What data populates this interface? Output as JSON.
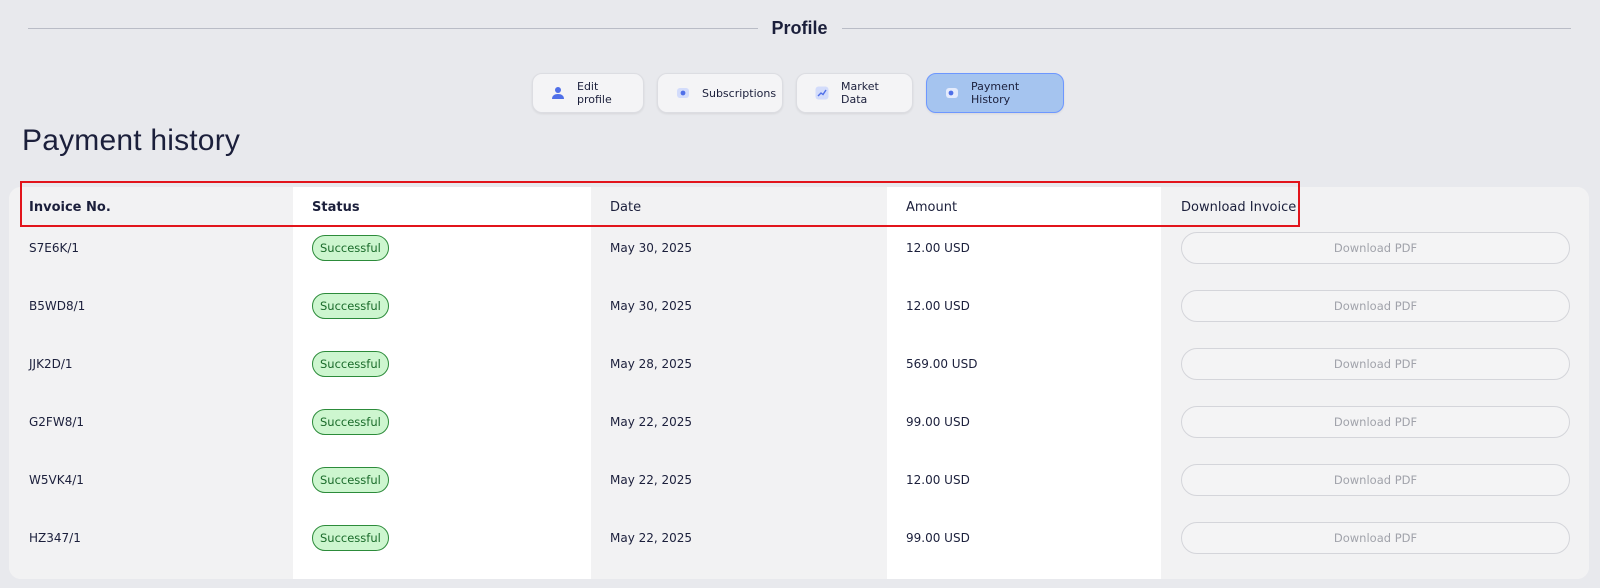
{
  "profile": {
    "title": "Profile"
  },
  "tabs": [
    {
      "label": "Edit profile",
      "icon": "user-icon",
      "active": false
    },
    {
      "label": "Subscriptions",
      "icon": "subscription-icon",
      "active": false
    },
    {
      "label": "Market Data",
      "icon": "chart-icon",
      "active": false
    },
    {
      "label": "Payment History",
      "icon": "payment-icon",
      "active": true
    }
  ],
  "page": {
    "title": "Payment history"
  },
  "table": {
    "headers": {
      "invoice": "Invoice No.",
      "status": "Status",
      "date": "Date",
      "amount": "Amount",
      "download": "Download Invoice"
    },
    "rows": [
      {
        "invoice": "S7E6K/1",
        "status": "Successful",
        "date": "May 30, 2025",
        "amount": "12.00 USD",
        "download": "Download PDF"
      },
      {
        "invoice": "B5WD8/1",
        "status": "Successful",
        "date": "May 30, 2025",
        "amount": "12.00 USD",
        "download": "Download PDF"
      },
      {
        "invoice": "JJK2D/1",
        "status": "Successful",
        "date": "May 28, 2025",
        "amount": "569.00 USD",
        "download": "Download PDF"
      },
      {
        "invoice": "G2FW8/1",
        "status": "Successful",
        "date": "May 22, 2025",
        "amount": "99.00 USD",
        "download": "Download PDF"
      },
      {
        "invoice": "W5VK4/1",
        "status": "Successful",
        "date": "May 22, 2025",
        "amount": "12.00 USD",
        "download": "Download PDF"
      },
      {
        "invoice": "HZ347/1",
        "status": "Successful",
        "date": "May 22, 2025",
        "amount": "99.00 USD",
        "download": "Download PDF"
      }
    ]
  },
  "colors": {
    "accent": "#6d97ff",
    "active_tab_bg": "#a5c4ef",
    "success_bg": "#cdf6cf",
    "success_border": "#2c8b3a",
    "highlight": "#e2141b"
  }
}
